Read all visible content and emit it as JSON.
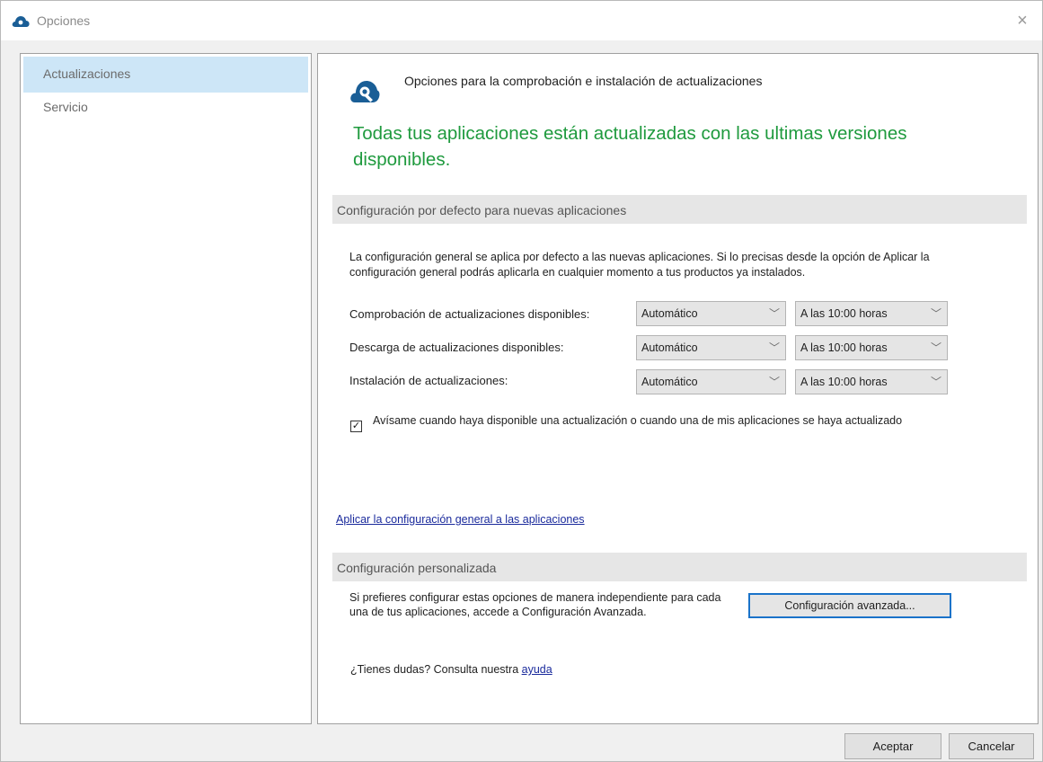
{
  "window": {
    "title": "Opciones",
    "close_glyph": "×"
  },
  "icons": {
    "app": "cloud-wrench-icon",
    "header": "wrench-icon",
    "chevron": "chevron-down-icon",
    "close": "close-icon"
  },
  "colors": {
    "brand": "#1a5e96",
    "success": "#1f9a3e",
    "selection": "#cde6f7",
    "link": "#1a2a9c",
    "focus": "#1a73c9"
  },
  "sidebar": {
    "items": [
      {
        "label": "Actualizaciones",
        "selected": true
      },
      {
        "label": "Servicio",
        "selected": false
      }
    ]
  },
  "main": {
    "header_title": "Opciones para la comprobación e instalación de actualizaciones",
    "status_message": "Todas tus aplicaciones están actualizadas con las ultimas versiones disponibles.",
    "default_section": {
      "title": "Configuración por defecto para nuevas aplicaciones",
      "description": "La configuración general se aplica por defecto a las nuevas aplicaciones. Si lo precisas desde la opción de Aplicar la configuración general podrás aplicarla en cualquier momento a tus productos ya instalados.",
      "rows": [
        {
          "label": "Comprobación de actualizaciones disponibles:",
          "mode": "Automático",
          "time": "A las 10:00 horas"
        },
        {
          "label": "Descarga de actualizaciones disponibles:",
          "mode": "Automático",
          "time": "A las 10:00 horas"
        },
        {
          "label": "Instalación de actualizaciones:",
          "mode": "Automático",
          "time": "A las 10:00 horas"
        }
      ],
      "notify_checkbox": {
        "label": "Avísame cuando haya disponible una actualización o cuando una de mis aplicaciones se haya actualizado",
        "checked": true,
        "glyph": "✓"
      },
      "apply_link": "Aplicar la configuración general a las aplicaciones"
    },
    "custom_section": {
      "title": "Configuración personalizada",
      "description": "Si prefieres configurar estas opciones de manera independiente para cada una de tus aplicaciones, accede a Configuración Avanzada.",
      "advanced_button": "Configuración avanzada..."
    },
    "help": {
      "text": "¿Tienes dudas? Consulta nuestra ",
      "link": "ayuda"
    }
  },
  "footer": {
    "accept": "Aceptar",
    "cancel": "Cancelar"
  }
}
